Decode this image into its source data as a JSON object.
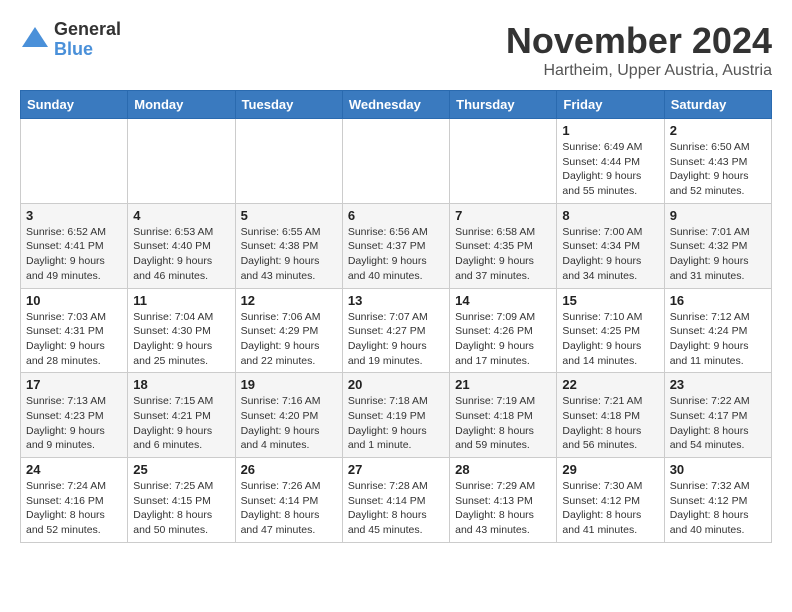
{
  "header": {
    "logo_line1": "General",
    "logo_line2": "Blue",
    "month_title": "November 2024",
    "location": "Hartheim, Upper Austria, Austria"
  },
  "weekdays": [
    "Sunday",
    "Monday",
    "Tuesday",
    "Wednesday",
    "Thursday",
    "Friday",
    "Saturday"
  ],
  "weeks": [
    [
      {
        "day": "",
        "info": ""
      },
      {
        "day": "",
        "info": ""
      },
      {
        "day": "",
        "info": ""
      },
      {
        "day": "",
        "info": ""
      },
      {
        "day": "",
        "info": ""
      },
      {
        "day": "1",
        "info": "Sunrise: 6:49 AM\nSunset: 4:44 PM\nDaylight: 9 hours and 55 minutes."
      },
      {
        "day": "2",
        "info": "Sunrise: 6:50 AM\nSunset: 4:43 PM\nDaylight: 9 hours and 52 minutes."
      }
    ],
    [
      {
        "day": "3",
        "info": "Sunrise: 6:52 AM\nSunset: 4:41 PM\nDaylight: 9 hours and 49 minutes."
      },
      {
        "day": "4",
        "info": "Sunrise: 6:53 AM\nSunset: 4:40 PM\nDaylight: 9 hours and 46 minutes."
      },
      {
        "day": "5",
        "info": "Sunrise: 6:55 AM\nSunset: 4:38 PM\nDaylight: 9 hours and 43 minutes."
      },
      {
        "day": "6",
        "info": "Sunrise: 6:56 AM\nSunset: 4:37 PM\nDaylight: 9 hours and 40 minutes."
      },
      {
        "day": "7",
        "info": "Sunrise: 6:58 AM\nSunset: 4:35 PM\nDaylight: 9 hours and 37 minutes."
      },
      {
        "day": "8",
        "info": "Sunrise: 7:00 AM\nSunset: 4:34 PM\nDaylight: 9 hours and 34 minutes."
      },
      {
        "day": "9",
        "info": "Sunrise: 7:01 AM\nSunset: 4:32 PM\nDaylight: 9 hours and 31 minutes."
      }
    ],
    [
      {
        "day": "10",
        "info": "Sunrise: 7:03 AM\nSunset: 4:31 PM\nDaylight: 9 hours and 28 minutes."
      },
      {
        "day": "11",
        "info": "Sunrise: 7:04 AM\nSunset: 4:30 PM\nDaylight: 9 hours and 25 minutes."
      },
      {
        "day": "12",
        "info": "Sunrise: 7:06 AM\nSunset: 4:29 PM\nDaylight: 9 hours and 22 minutes."
      },
      {
        "day": "13",
        "info": "Sunrise: 7:07 AM\nSunset: 4:27 PM\nDaylight: 9 hours and 19 minutes."
      },
      {
        "day": "14",
        "info": "Sunrise: 7:09 AM\nSunset: 4:26 PM\nDaylight: 9 hours and 17 minutes."
      },
      {
        "day": "15",
        "info": "Sunrise: 7:10 AM\nSunset: 4:25 PM\nDaylight: 9 hours and 14 minutes."
      },
      {
        "day": "16",
        "info": "Sunrise: 7:12 AM\nSunset: 4:24 PM\nDaylight: 9 hours and 11 minutes."
      }
    ],
    [
      {
        "day": "17",
        "info": "Sunrise: 7:13 AM\nSunset: 4:23 PM\nDaylight: 9 hours and 9 minutes."
      },
      {
        "day": "18",
        "info": "Sunrise: 7:15 AM\nSunset: 4:21 PM\nDaylight: 9 hours and 6 minutes."
      },
      {
        "day": "19",
        "info": "Sunrise: 7:16 AM\nSunset: 4:20 PM\nDaylight: 9 hours and 4 minutes."
      },
      {
        "day": "20",
        "info": "Sunrise: 7:18 AM\nSunset: 4:19 PM\nDaylight: 9 hours and 1 minute."
      },
      {
        "day": "21",
        "info": "Sunrise: 7:19 AM\nSunset: 4:18 PM\nDaylight: 8 hours and 59 minutes."
      },
      {
        "day": "22",
        "info": "Sunrise: 7:21 AM\nSunset: 4:18 PM\nDaylight: 8 hours and 56 minutes."
      },
      {
        "day": "23",
        "info": "Sunrise: 7:22 AM\nSunset: 4:17 PM\nDaylight: 8 hours and 54 minutes."
      }
    ],
    [
      {
        "day": "24",
        "info": "Sunrise: 7:24 AM\nSunset: 4:16 PM\nDaylight: 8 hours and 52 minutes."
      },
      {
        "day": "25",
        "info": "Sunrise: 7:25 AM\nSunset: 4:15 PM\nDaylight: 8 hours and 50 minutes."
      },
      {
        "day": "26",
        "info": "Sunrise: 7:26 AM\nSunset: 4:14 PM\nDaylight: 8 hours and 47 minutes."
      },
      {
        "day": "27",
        "info": "Sunrise: 7:28 AM\nSunset: 4:14 PM\nDaylight: 8 hours and 45 minutes."
      },
      {
        "day": "28",
        "info": "Sunrise: 7:29 AM\nSunset: 4:13 PM\nDaylight: 8 hours and 43 minutes."
      },
      {
        "day": "29",
        "info": "Sunrise: 7:30 AM\nSunset: 4:12 PM\nDaylight: 8 hours and 41 minutes."
      },
      {
        "day": "30",
        "info": "Sunrise: 7:32 AM\nSunset: 4:12 PM\nDaylight: 8 hours and 40 minutes."
      }
    ]
  ]
}
